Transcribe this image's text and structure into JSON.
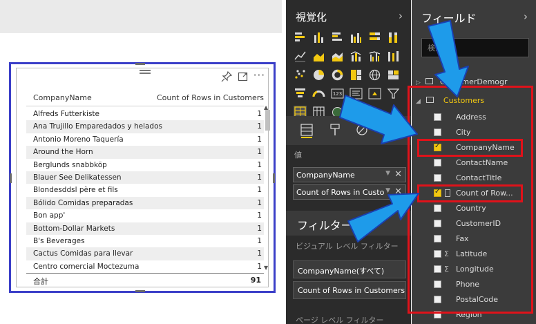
{
  "visual": {
    "table": {
      "columns": [
        "CompanyName",
        "Count of Rows in Customers"
      ],
      "rows": [
        {
          "name": "Alfreds Futterkiste",
          "count": "1"
        },
        {
          "name": "Ana Trujillo Emparedados y helados",
          "count": "1"
        },
        {
          "name": "Antonio Moreno Taquería",
          "count": "1"
        },
        {
          "name": "Around the Horn",
          "count": "1"
        },
        {
          "name": "Berglunds snabbköp",
          "count": "1"
        },
        {
          "name": "Blauer See Delikatessen",
          "count": "1"
        },
        {
          "name": "Blondesddsl père et fils",
          "count": "1"
        },
        {
          "name": "Bólido Comidas preparadas",
          "count": "1"
        },
        {
          "name": "Bon app'",
          "count": "1"
        },
        {
          "name": "Bottom-Dollar Markets",
          "count": "1"
        },
        {
          "name": "B's Beverages",
          "count": "1"
        },
        {
          "name": "Cactus Comidas para llevar",
          "count": "1"
        },
        {
          "name": "Centro comercial Moctezuma",
          "count": "1"
        }
      ],
      "total_label": "合計",
      "total_value": "91"
    },
    "icons": [
      "pin-icon",
      "focus-mode-icon",
      "more-options-icon"
    ]
  },
  "viz_pane": {
    "title": "視覚化",
    "chevron": "›",
    "values_label": "値",
    "wells": [
      {
        "label": "CompanyName"
      },
      {
        "label": "Count of Rows in Customers"
      }
    ],
    "filters_title": "フィルター",
    "visual_filters_label": "ビジュアル レベル フィルター",
    "visual_filters": [
      {
        "label": "CompanyName(すべて)"
      },
      {
        "label": "Count of Rows in Customers"
      }
    ],
    "page_filters_label": "ページ レベル フィルター"
  },
  "fields_pane": {
    "title": "フィールド",
    "chevron": "›",
    "search_placeholder": "検索",
    "tables": [
      {
        "name": "CustomerDemogr"
      },
      {
        "name": "Customers",
        "expanded": true
      }
    ],
    "fields": [
      {
        "name": "Address",
        "checked": false,
        "type": "text"
      },
      {
        "name": "City",
        "checked": false,
        "type": "text"
      },
      {
        "name": "CompanyName",
        "checked": true,
        "type": "text"
      },
      {
        "name": "ContactName",
        "checked": false,
        "type": "text"
      },
      {
        "name": "ContactTitle",
        "checked": false,
        "type": "text"
      },
      {
        "name": "Count of Row...",
        "checked": true,
        "type": "calc"
      },
      {
        "name": "Country",
        "checked": false,
        "type": "text"
      },
      {
        "name": "CustomerID",
        "checked": false,
        "type": "text"
      },
      {
        "name": "Fax",
        "checked": false,
        "type": "text"
      },
      {
        "name": "Latitude",
        "checked": false,
        "type": "sum"
      },
      {
        "name": "Longitude",
        "checked": false,
        "type": "sum"
      },
      {
        "name": "Phone",
        "checked": false,
        "type": "text"
      },
      {
        "name": "PostalCode",
        "checked": false,
        "type": "text"
      },
      {
        "name": "Region",
        "checked": false,
        "type": "text"
      }
    ]
  },
  "colors": {
    "accent": "#f2c811",
    "annotation_red": "#e0121a",
    "annotation_arrow": "#1e9bea",
    "selection_frame": "#3b3fc8",
    "pane_dark": "#2b2b2b"
  }
}
